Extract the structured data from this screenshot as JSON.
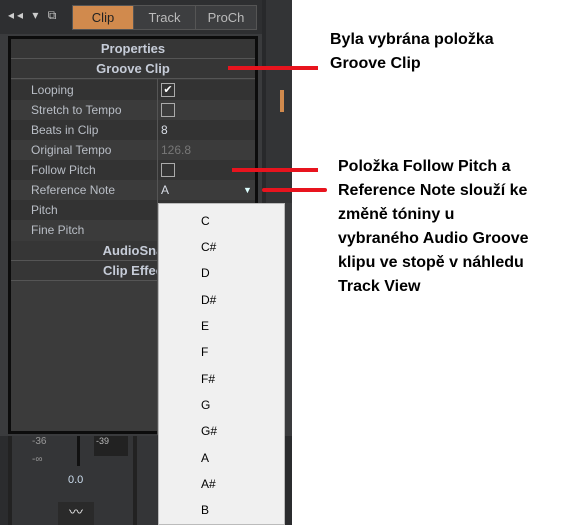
{
  "tabs": [
    "Clip",
    "Track",
    "ProCh"
  ],
  "active_tab": "Clip",
  "panel": {
    "title": "Properties",
    "section": "Groove Clip",
    "rows": [
      {
        "label": "Looping",
        "checked": true
      },
      {
        "label": "Stretch to Tempo",
        "checked": false
      },
      {
        "label": "Beats in Clip",
        "value": "8"
      },
      {
        "label": "Original Tempo",
        "value": "126.8"
      },
      {
        "label": "Follow Pitch",
        "checked": false
      },
      {
        "label": "Reference Note",
        "value": "A"
      },
      {
        "label": "Pitch"
      },
      {
        "label": "Fine Pitch"
      }
    ],
    "sections_after": [
      "AudioSna",
      "Clip Effec"
    ]
  },
  "dropdown": {
    "options": [
      "C",
      "C#",
      "D",
      "D#",
      "E",
      "F",
      "F#",
      "G",
      "G#",
      "A",
      "A#",
      "B"
    ]
  },
  "mixer": {
    "scale": [
      "-36",
      "-∞"
    ],
    "peak": "-39",
    "volume": "0.0"
  },
  "annotations": {
    "note1": [
      "Byla vybrána položka",
      "Groove Clip"
    ],
    "note2": [
      "Položka Follow Pitch a",
      "Reference Note slouží ke",
      "změně tóniny u",
      "vybraného Audio Groove",
      "klipu ve stopě v náhledu",
      "Track View"
    ],
    "color": "#e8141e"
  }
}
